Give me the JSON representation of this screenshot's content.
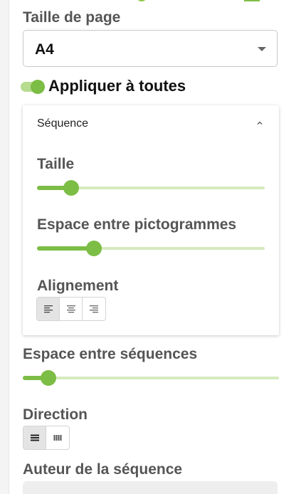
{
  "page_size": {
    "label": "Taille de page",
    "selected": "A4"
  },
  "apply_all": {
    "label": "Appliquer à toutes",
    "on": true
  },
  "sequence_panel": {
    "header": "Séquence",
    "expanded": true,
    "size": {
      "label": "Taille",
      "value_percent": 15
    },
    "pictogram_spacing": {
      "label": "Espace entre pictogrammes",
      "value_percent": 25
    },
    "alignment": {
      "label": "Alignement",
      "options": [
        "align-left-icon",
        "align-center-icon",
        "align-right-icon"
      ],
      "selected": "align-left-icon"
    }
  },
  "sequence_spacing": {
    "label": "Espace entre séquences",
    "value_percent": 10
  },
  "direction": {
    "label": "Direction",
    "options": [
      "rows-icon",
      "columns-icon"
    ],
    "selected": "rows-icon"
  },
  "author": {
    "label": "Auteur de la séquence",
    "value": ""
  },
  "colors": {
    "accent": "#7cbd45",
    "track": "#d5ebbe",
    "label_grey": "#555555"
  }
}
